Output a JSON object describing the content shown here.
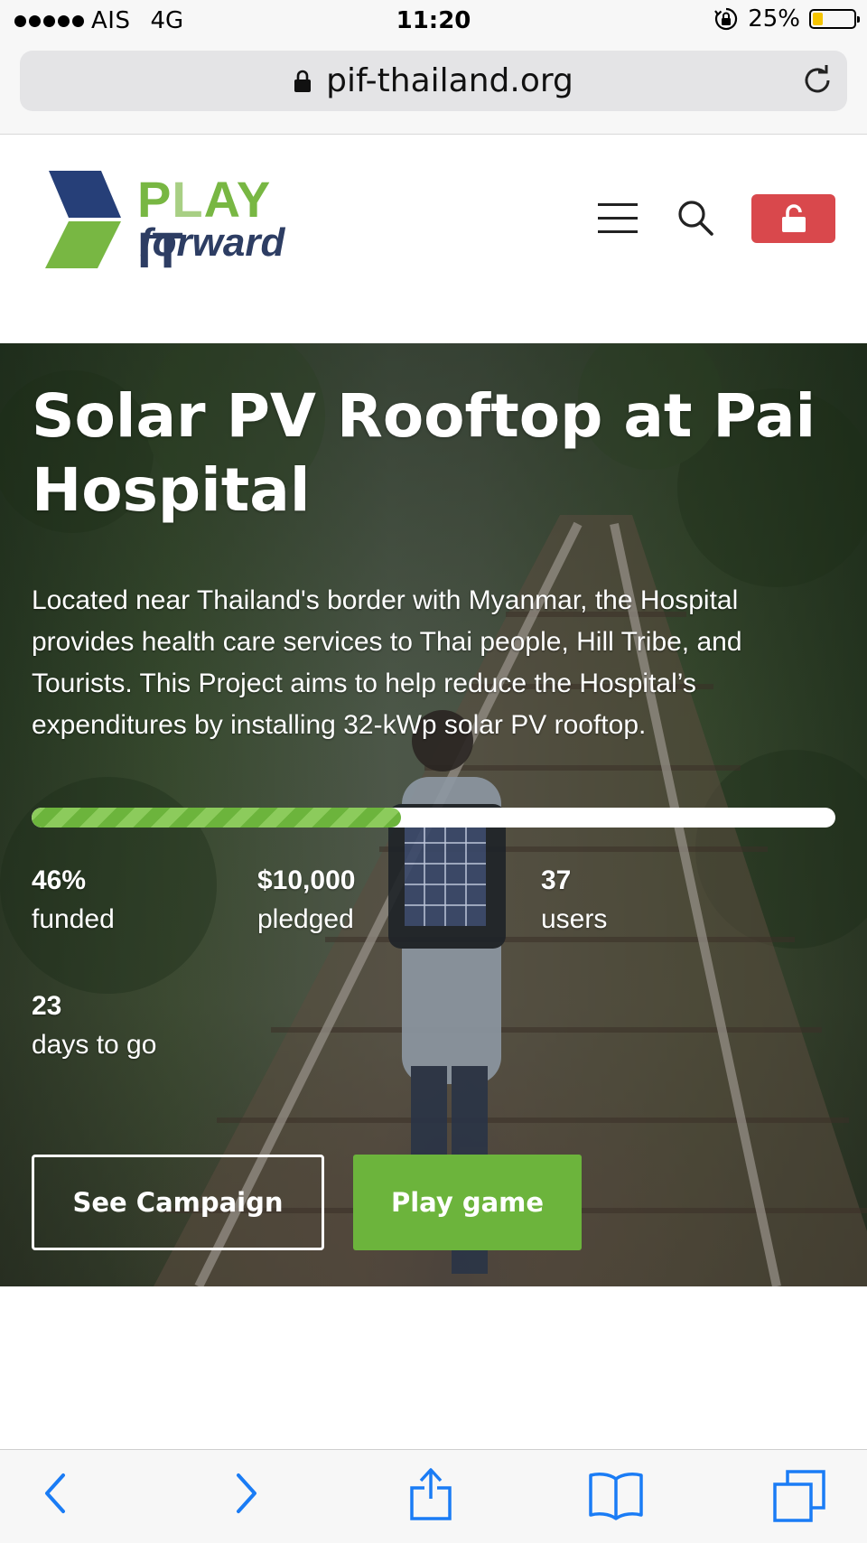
{
  "status_bar": {
    "carrier": "AIS",
    "network": "4G",
    "time": "11:20",
    "battery": "25%",
    "battery_level": 0.25
  },
  "browser": {
    "url": "pif-thailand.org"
  },
  "header": {
    "logo_text_play": "PLAY",
    "logo_text_it": "IT",
    "logo_text_forward": "forward"
  },
  "hero": {
    "title": "Solar PV Rooftop at Pai Hospital",
    "description": "Located near Thailand's border with Myanmar, the Hospital provides health care services to Thai people, Hill Tribe, and Tourists. This Project aims to help reduce the Hospital’s expenditures by installing 32-kWp solar PV rooftop.",
    "progress_fraction": 0.46,
    "stats": {
      "funded": {
        "value": "46%",
        "label": "funded"
      },
      "pledged": {
        "value": "$10,000",
        "label": "pledged"
      },
      "users": {
        "value": "37",
        "label": "users"
      },
      "days": {
        "value": "23",
        "label": "days to go"
      }
    },
    "see_campaign_label": "See Campaign",
    "play_game_label": "Play game"
  },
  "colors": {
    "brand_green": "#6cb43c",
    "brand_navy": "#2d3d63",
    "unlock_red": "#d9484c"
  }
}
